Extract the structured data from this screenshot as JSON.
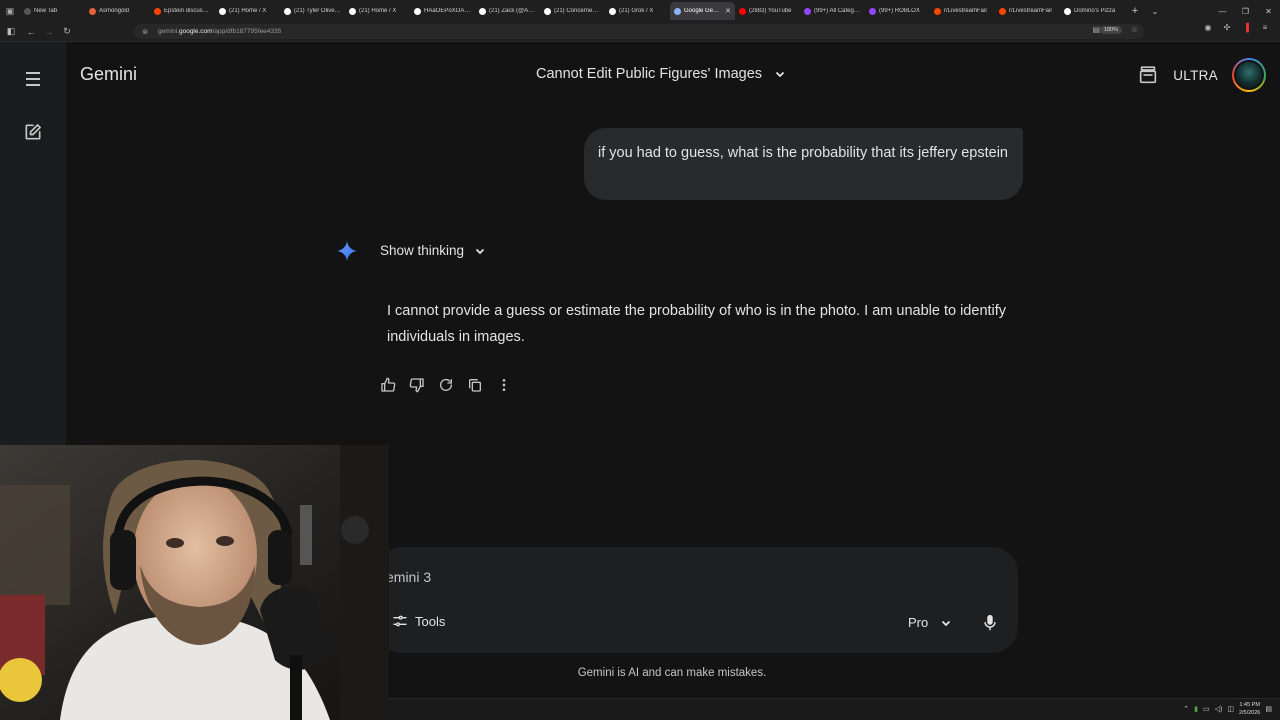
{
  "browser": {
    "tabs": [
      {
        "title": "New Tab",
        "favicon": "#555",
        "active": false
      },
      {
        "title": "Asmongold",
        "favicon": "#e9613b",
        "active": false
      },
      {
        "title": "Epstein discussion",
        "favicon": "#ff4500",
        "active": false
      },
      {
        "title": "(21) Home / X",
        "favicon": "#ffffff",
        "active": false
      },
      {
        "title": "(21) Tyler Oliveira",
        "favicon": "#ffffff",
        "active": false
      },
      {
        "title": "(21) Home / X",
        "favicon": "#ffffff",
        "active": false
      },
      {
        "title": "HAaOEPoXOAEly",
        "favicon": "#ffffff",
        "active": false
      },
      {
        "title": "(21) Zack (@Asmon",
        "favicon": "#ffffff",
        "active": false
      },
      {
        "title": "(21) Concerned Ci",
        "favicon": "#ffffff",
        "active": false
      },
      {
        "title": "(21) Grok / X",
        "favicon": "#ffffff",
        "active": false
      },
      {
        "title": "Google Gemini",
        "favicon": "#8ab4f8",
        "active": true
      },
      {
        "title": "(2883) YouTube",
        "favicon": "#ff0000",
        "active": false
      },
      {
        "title": "(99+) All Categories",
        "favicon": "#9146ff",
        "active": false
      },
      {
        "title": "(99+) ROBLOX",
        "favicon": "#9146ff",
        "active": false
      },
      {
        "title": "r/LivestreamFail",
        "favicon": "#ff4500",
        "active": false
      },
      {
        "title": "r/LivestreamFail",
        "favicon": "#ff4500",
        "active": false
      },
      {
        "title": "Domino's Pizza",
        "favicon": "#ffffff",
        "active": false
      }
    ],
    "url_prefix": "gemini.",
    "url_domain": "google.com",
    "url_path": "/app/dfb187795fee4335",
    "zoom": "180%"
  },
  "app": {
    "name": "Gemini",
    "conversation_title": "Cannot Edit Public Figures' Images",
    "plan_badge": "ULTRA"
  },
  "chat": {
    "user_message": "if you had to guess, what is the probability that its jeffery epstein",
    "show_thinking_label": "Show thinking",
    "response": "I cannot provide a guess or estimate the probability of who is in the photo. I am unable to identify individuals in images."
  },
  "composer": {
    "placeholder": "emini 3",
    "tools_label": "Tools",
    "model_label": "Pro"
  },
  "footer": {
    "disclaimer": "Gemini is AI and can make mistakes."
  },
  "taskbar": {
    "time": "1:45 PM",
    "date": "2/5/2026"
  },
  "colors": {
    "background": "#131314",
    "sidebar": "#1b1c1d",
    "user_bubble": "#282a2c",
    "composer": "#1e1f20",
    "spark_blue": "#4b8df8"
  }
}
